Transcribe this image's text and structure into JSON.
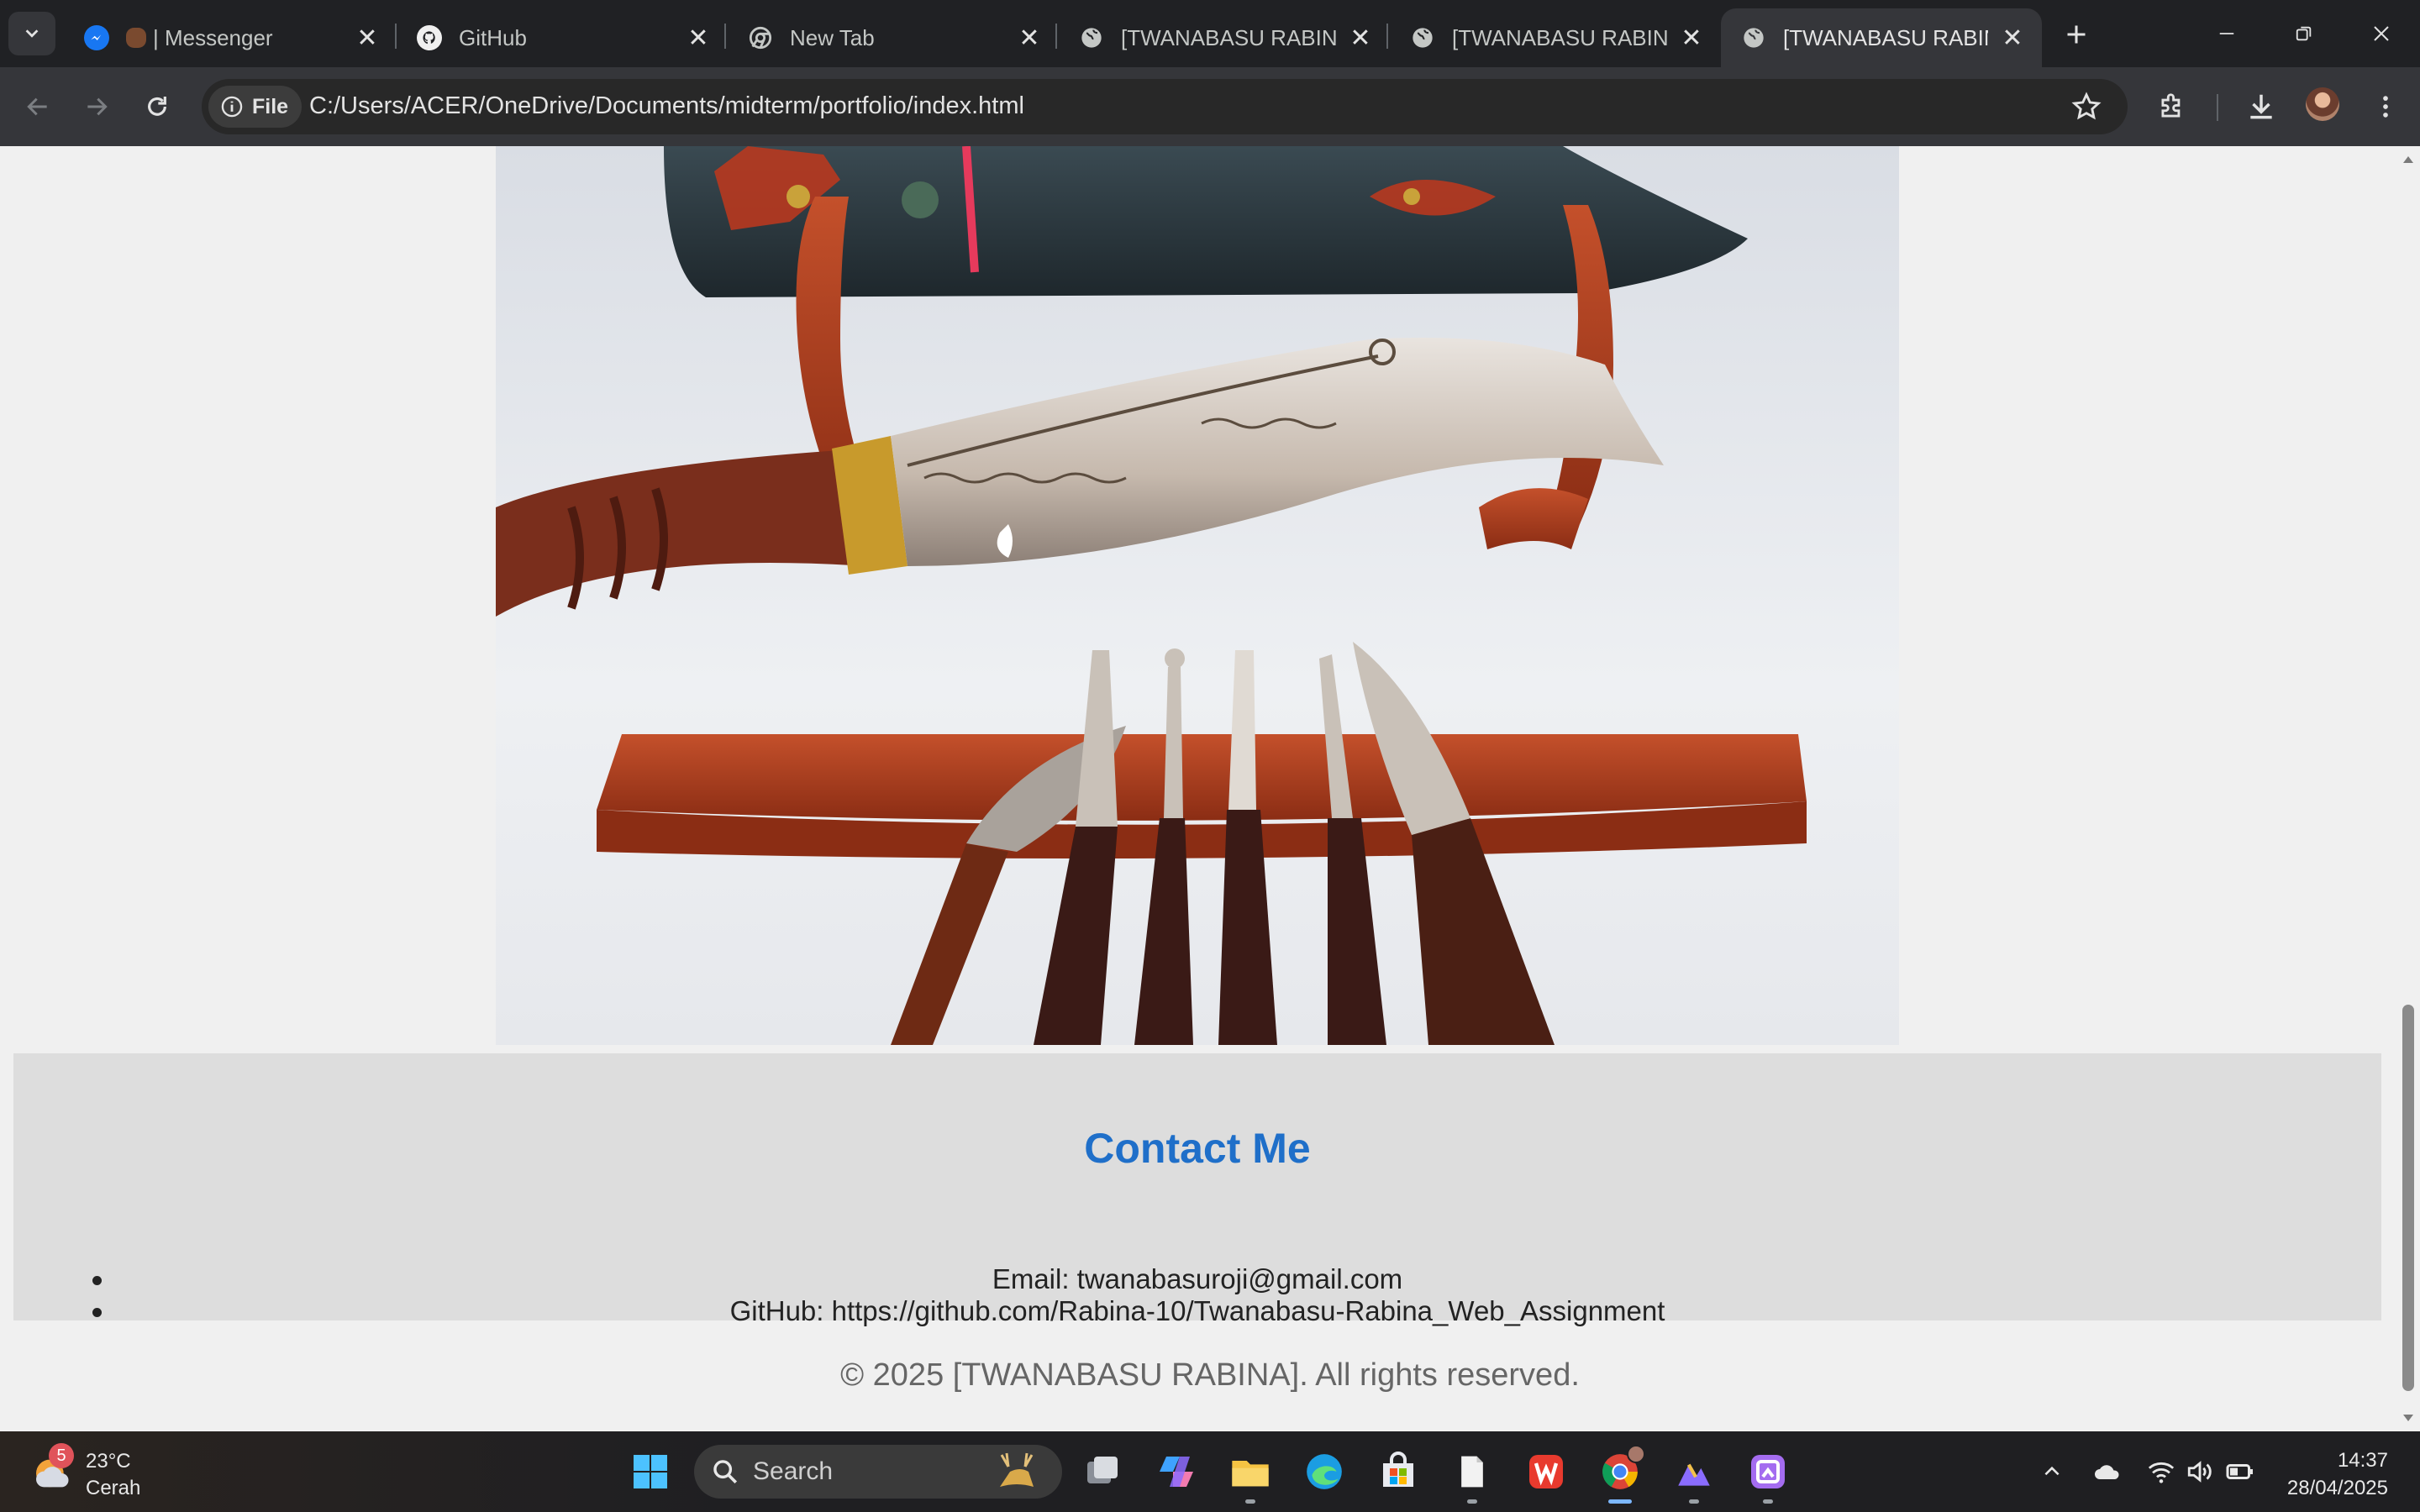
{
  "browser": {
    "tabs": [
      {
        "label": "| Messenger",
        "icon": "messenger-icon",
        "active": false
      },
      {
        "label": "GitHub",
        "icon": "github-icon",
        "active": false
      },
      {
        "label": "New Tab",
        "icon": "chrome-icon",
        "active": false
      },
      {
        "label": "[TWANABASU RABINA]",
        "icon": "globe-icon",
        "active": false
      },
      {
        "label": "[TWANABASU RABINA]",
        "icon": "globe-icon",
        "active": false
      },
      {
        "label": "[TWANABASU RABINA]",
        "icon": "globe-icon",
        "active": true
      }
    ],
    "address": {
      "chip_label": "File",
      "url": "C:/Users/ACER/OneDrive/Documents/midterm/portfolio/index.html"
    }
  },
  "page": {
    "contact": {
      "heading": "Contact Me",
      "items": [
        "Email: twanabasuroji@gmail.com",
        "GitHub: https://github.com/Rabina-10/Twanabasu-Rabina_Web_Assignment"
      ]
    },
    "footer": "© 2025 [TWANABASU RABINA]. All rights reserved.",
    "hero_image": "khukuri-knife-with-scabbard-and-tools"
  },
  "taskbar": {
    "weather": {
      "temp": "23°C",
      "condition": "Cerah",
      "badge": "5"
    },
    "search_placeholder": "Search",
    "apps": [
      "task-view-icon",
      "copilot-icon",
      "file-explorer-icon",
      "edge-icon",
      "store-icon",
      "notepad-icon",
      "wps-icon",
      "chrome-icon",
      "sketch-icon",
      "snipping-tool-icon"
    ],
    "clock": {
      "time": "14:37",
      "date": "28/04/2025"
    }
  },
  "colors": {
    "accent_heading": "#1f6fc9",
    "page_bg": "#f0f0f0",
    "contact_bg": "#dddddd",
    "browser_dark": "#202124"
  }
}
